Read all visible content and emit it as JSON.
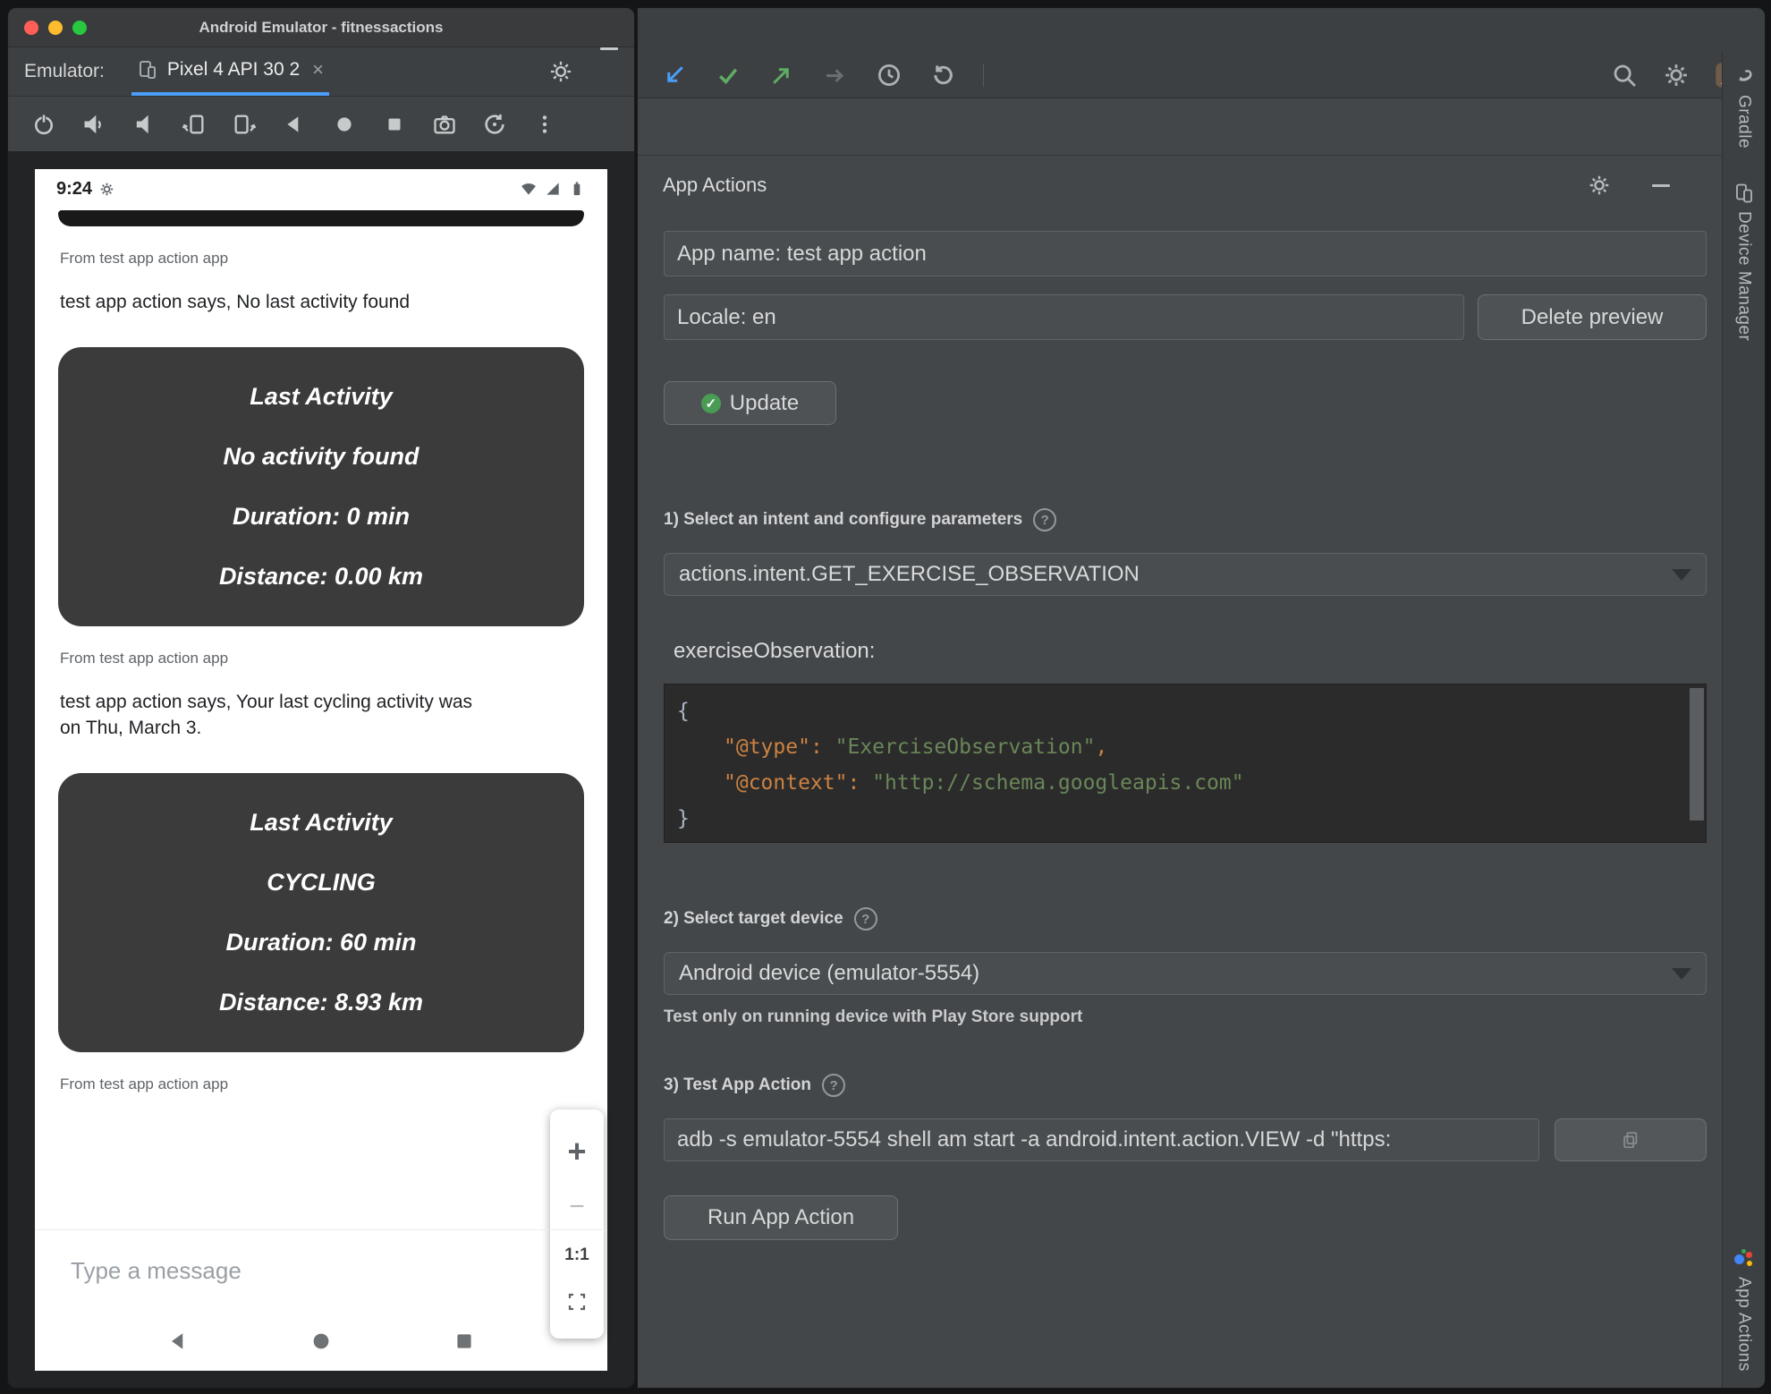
{
  "colors": {
    "accent_blue": "#4a9df8",
    "code_key": "#cc8242",
    "code_string": "#6a8759",
    "card_bg": "#3b3b3b",
    "ide_bg": "#44474a"
  },
  "emulator": {
    "window_title": "Android Emulator - fitnessactions",
    "toolbar_label": "Emulator:",
    "tab_label": "Pixel 4 API 30 2",
    "tab_close": "×",
    "phone": {
      "time": "9:24",
      "chat": {
        "from1": "From test app action app",
        "msg1": "test app action says, No last activity found",
        "card1": {
          "title": "Last Activity",
          "l1": "No activity found",
          "l2": "Duration: 0 min",
          "l3": "Distance: 0.00 km"
        },
        "from2": "From test app action app",
        "msg2": "test app action says, Your last cycling activity was on Thu, March 3.",
        "card2": {
          "title": "Last Activity",
          "l1": "CYCLING",
          "l2": "Duration: 60 min",
          "l3": "Distance: 8.93 km"
        },
        "from3": "From test app action app"
      },
      "zoom": {
        "plus": "+",
        "minus": "−",
        "ratio": "1:1"
      },
      "input_placeholder": "Type a message"
    }
  },
  "ide": {
    "panel_title": "App Actions",
    "app_name_value": "App name: test app action",
    "locale_value": "Locale: en",
    "delete_preview_label": "Delete preview",
    "update_label": "Update",
    "update_check": "✓",
    "help": "?",
    "section1_label": "1) Select an intent and configure parameters",
    "intent_value": "actions.intent.GET_EXERCISE_OBSERVATION",
    "param_label": "exerciseObservation:",
    "code": {
      "brace_open": "{",
      "key1": "\"@type\"",
      "colon1": ": ",
      "val1": "\"ExerciseObservation\"",
      "comma1": ",",
      "key2": "\"@context\"",
      "colon2": ": ",
      "val2": "\"http://schema.googleapis.com\"",
      "brace_close": "}"
    },
    "section2_label": "2) Select target device",
    "device_value": "Android device (emulator-5554)",
    "device_note": "Test only on running device with Play Store support",
    "section3_label": "3) Test App Action",
    "command_value": "adb -s emulator-5554 shell am start -a android.intent.action.VIEW -d \"https:",
    "run_label": "Run App Action",
    "side": {
      "gradle": "Gradle",
      "device_manager": "Device Manager",
      "app_actions": "App Actions"
    }
  }
}
